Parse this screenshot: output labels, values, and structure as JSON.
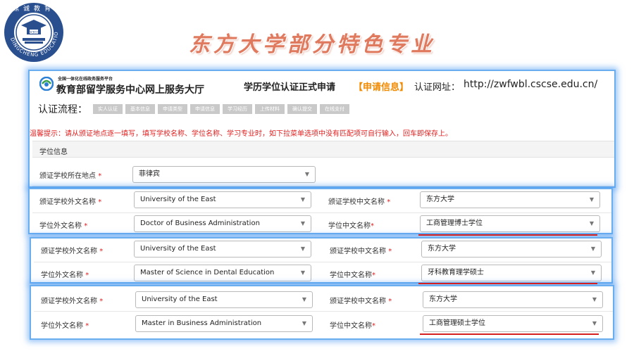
{
  "logo": {
    "name": "鼎诚教育",
    "ring_text": "DINGCHENG EDUCATION",
    "badge": "DCECC"
  },
  "slide_title": "东方大学部分特色专业",
  "portal": {
    "small_title": "全国一体化在线政务服务平台",
    "main_title": "教育部留学服务中心网上服务大厅",
    "cert_title": "学历学位认证正式申请",
    "bracket_label": "【申请信息】",
    "url_label": "认证网址：",
    "url": "http://zwfwbl.cscse.edu.cn/"
  },
  "flow": {
    "label": "认证流程：",
    "steps": [
      "实人认证",
      "基本信息",
      "申请类型",
      "申请信息",
      "学习经历",
      "上传材料",
      "确认提交",
      "在线支付"
    ]
  },
  "tip": "温馨提示：请从颁证地点逐一填写，填写学校名称、学位名称、学习专业时，如下拉菜单选项中没有匹配项可自行输入，回车即保存上。",
  "section": {
    "title": "学位信息"
  },
  "labels": {
    "location": "颁证学校所在地点",
    "school_foreign": "颁证学校外文名称",
    "school_chinese": "颁证学校中文名称",
    "degree_foreign": "学位外文名称",
    "degree_chinese": "学位中文名称",
    "required": "*"
  },
  "location_value": "菲律宾",
  "entries": [
    {
      "school_foreign": "University of the East",
      "school_chinese": "东方大学",
      "degree_foreign": "Doctor of Business Administration",
      "degree_chinese": "工商管理博士学位"
    },
    {
      "school_foreign": "University of the East",
      "school_chinese": "东方大学",
      "degree_foreign": "Master of Science in Dental Education",
      "degree_chinese": "牙科教育理学硕士"
    },
    {
      "school_foreign": "University of the East",
      "school_chinese": "东方大学",
      "degree_foreign": "Master in Business Administration",
      "degree_chinese": "工商管理硕士学位"
    }
  ],
  "dropdown_arrow": "▼",
  "colors": {
    "glow": "#6aaef0",
    "tip": "#e02020",
    "accent": "#f08a00",
    "title": "#e07a5f",
    "underline": "#d42020",
    "logo_blue": "#2a4f8f"
  }
}
